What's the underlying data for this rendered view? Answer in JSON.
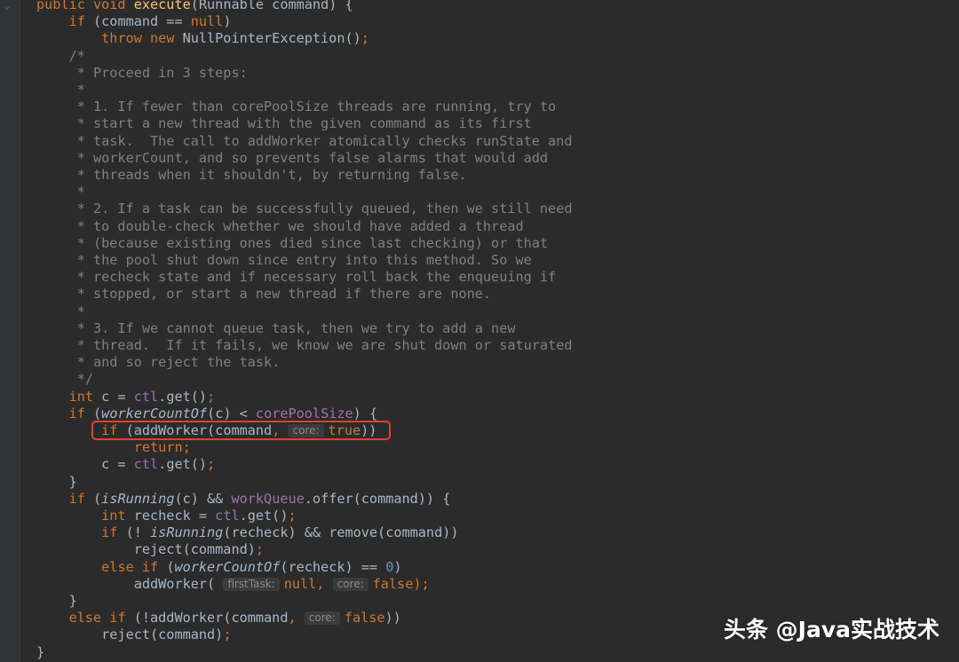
{
  "lines": [
    [
      {
        "t": "public void ",
        "c": "kw"
      },
      {
        "t": "execute",
        "c": "fn"
      },
      {
        "t": "(Runnable command) {",
        "c": ""
      }
    ],
    [
      {
        "t": "    "
      },
      {
        "t": "if ",
        "c": "kw"
      },
      {
        "t": "(command == "
      },
      {
        "t": "null",
        "c": "kw"
      },
      {
        "t": ")"
      }
    ],
    [
      {
        "t": "        "
      },
      {
        "t": "throw new ",
        "c": "kw"
      },
      {
        "t": "NullPointerException()"
      },
      {
        "t": ";",
        "c": "kw"
      }
    ],
    [
      {
        "t": "    /*",
        "c": "cm"
      }
    ],
    [
      {
        "t": "     * Proceed in 3 steps:",
        "c": "cm"
      }
    ],
    [
      {
        "t": "     *",
        "c": "cm"
      }
    ],
    [
      {
        "t": "     * 1. If fewer than corePoolSize threads are running, try to",
        "c": "cm"
      }
    ],
    [
      {
        "t": "     * start a new thread with the given command as its first",
        "c": "cm"
      }
    ],
    [
      {
        "t": "     * task.  The call to addWorker atomically checks runState and",
        "c": "cm"
      }
    ],
    [
      {
        "t": "     * workerCount, and so prevents false alarms that would add",
        "c": "cm"
      }
    ],
    [
      {
        "t": "     * threads when it shouldn't, by returning false.",
        "c": "cm"
      }
    ],
    [
      {
        "t": "     *",
        "c": "cm"
      }
    ],
    [
      {
        "t": "     * 2. If a task can be successfully queued, then we still need",
        "c": "cm"
      }
    ],
    [
      {
        "t": "     * to double-check whether we should have added a thread",
        "c": "cm"
      }
    ],
    [
      {
        "t": "     * (because existing ones died since last checking) or that",
        "c": "cm"
      }
    ],
    [
      {
        "t": "     * the pool shut down since entry into this method. So we",
        "c": "cm"
      }
    ],
    [
      {
        "t": "     * recheck state and if necessary roll back the enqueuing if",
        "c": "cm"
      }
    ],
    [
      {
        "t": "     * stopped, or start a new thread if there are none.",
        "c": "cm"
      }
    ],
    [
      {
        "t": "     *",
        "c": "cm"
      }
    ],
    [
      {
        "t": "     * 3. If we cannot queue task, then we try to add a new",
        "c": "cm"
      }
    ],
    [
      {
        "t": "     * thread.  If it fails, we know we are shut down or saturated",
        "c": "cm"
      }
    ],
    [
      {
        "t": "     * and so reject the task.",
        "c": "cm"
      }
    ],
    [
      {
        "t": "     */",
        "c": "cm"
      }
    ],
    [
      {
        "t": "    "
      },
      {
        "t": "int ",
        "c": "kw"
      },
      {
        "t": "c = "
      },
      {
        "t": "ctl",
        "c": "fld"
      },
      {
        "t": ".get()"
      },
      {
        "t": ";",
        "c": "kw"
      }
    ],
    [
      {
        "t": "    "
      },
      {
        "t": "if ",
        "c": "kw"
      },
      {
        "t": "("
      },
      {
        "t": "workerCountOf",
        "c": "it"
      },
      {
        "t": "(c) < "
      },
      {
        "t": "corePoolSize",
        "c": "fld"
      },
      {
        "t": ") {"
      }
    ],
    [
      {
        "t": "        "
      },
      {
        "t": "if ",
        "c": "kw"
      },
      {
        "t": "(addWorker(command"
      },
      {
        "t": ", ",
        "c": "kw"
      },
      {
        "h": "core:"
      },
      {
        "t": "true",
        "c": "kw"
      },
      {
        "t": "))"
      }
    ],
    [
      {
        "t": "            "
      },
      {
        "t": "return;",
        "c": "kw"
      }
    ],
    [
      {
        "t": "        c = "
      },
      {
        "t": "ctl",
        "c": "fld"
      },
      {
        "t": ".get()"
      },
      {
        "t": ";",
        "c": "kw"
      }
    ],
    [
      {
        "t": "    }"
      }
    ],
    [
      {
        "t": "    "
      },
      {
        "t": "if ",
        "c": "kw"
      },
      {
        "t": "("
      },
      {
        "t": "isRunning",
        "c": "it"
      },
      {
        "t": "(c) && "
      },
      {
        "t": "workQueue",
        "c": "fld"
      },
      {
        "t": ".offer(command)) {"
      }
    ],
    [
      {
        "t": "        "
      },
      {
        "t": "int ",
        "c": "kw"
      },
      {
        "t": "recheck = "
      },
      {
        "t": "ctl",
        "c": "fld"
      },
      {
        "t": ".get()"
      },
      {
        "t": ";",
        "c": "kw"
      }
    ],
    [
      {
        "t": "        "
      },
      {
        "t": "if ",
        "c": "kw"
      },
      {
        "t": "(! "
      },
      {
        "t": "isRunning",
        "c": "it"
      },
      {
        "t": "(recheck) && remove(command))"
      }
    ],
    [
      {
        "t": "            reject(command)"
      },
      {
        "t": ";",
        "c": "kw"
      }
    ],
    [
      {
        "t": "        "
      },
      {
        "t": "else if ",
        "c": "kw"
      },
      {
        "t": "("
      },
      {
        "t": "workerCountOf",
        "c": "it"
      },
      {
        "t": "(recheck) == "
      },
      {
        "t": "0",
        "c": "num"
      },
      {
        "t": ")"
      }
    ],
    [
      {
        "t": "            addWorker( "
      },
      {
        "h": "firstTask:"
      },
      {
        "t": "null, ",
        "c": "kw"
      },
      {
        "h": "core:"
      },
      {
        "t": "false",
        "c": "kw"
      },
      {
        "t": ");",
        "c": "kw"
      }
    ],
    [
      {
        "t": "    }"
      }
    ],
    [
      {
        "t": "    "
      },
      {
        "t": "else if ",
        "c": "kw"
      },
      {
        "t": "(!addWorker(command"
      },
      {
        "t": ", ",
        "c": "kw"
      },
      {
        "h": "core:"
      },
      {
        "t": "false",
        "c": "kw"
      },
      {
        "t": "))"
      }
    ],
    [
      {
        "t": "        reject(command)"
      },
      {
        "t": ";",
        "c": "kw"
      }
    ],
    [
      {
        "t": "}"
      }
    ]
  ],
  "watermark": "头条 @Java实战技术",
  "colors": {
    "background": "#2b2b2b",
    "keyword": "#cc7832",
    "function": "#ffc66d",
    "comment": "#808080",
    "field": "#9876aa",
    "text": "#a9b7c6",
    "highlight_box": "#e3412b"
  }
}
